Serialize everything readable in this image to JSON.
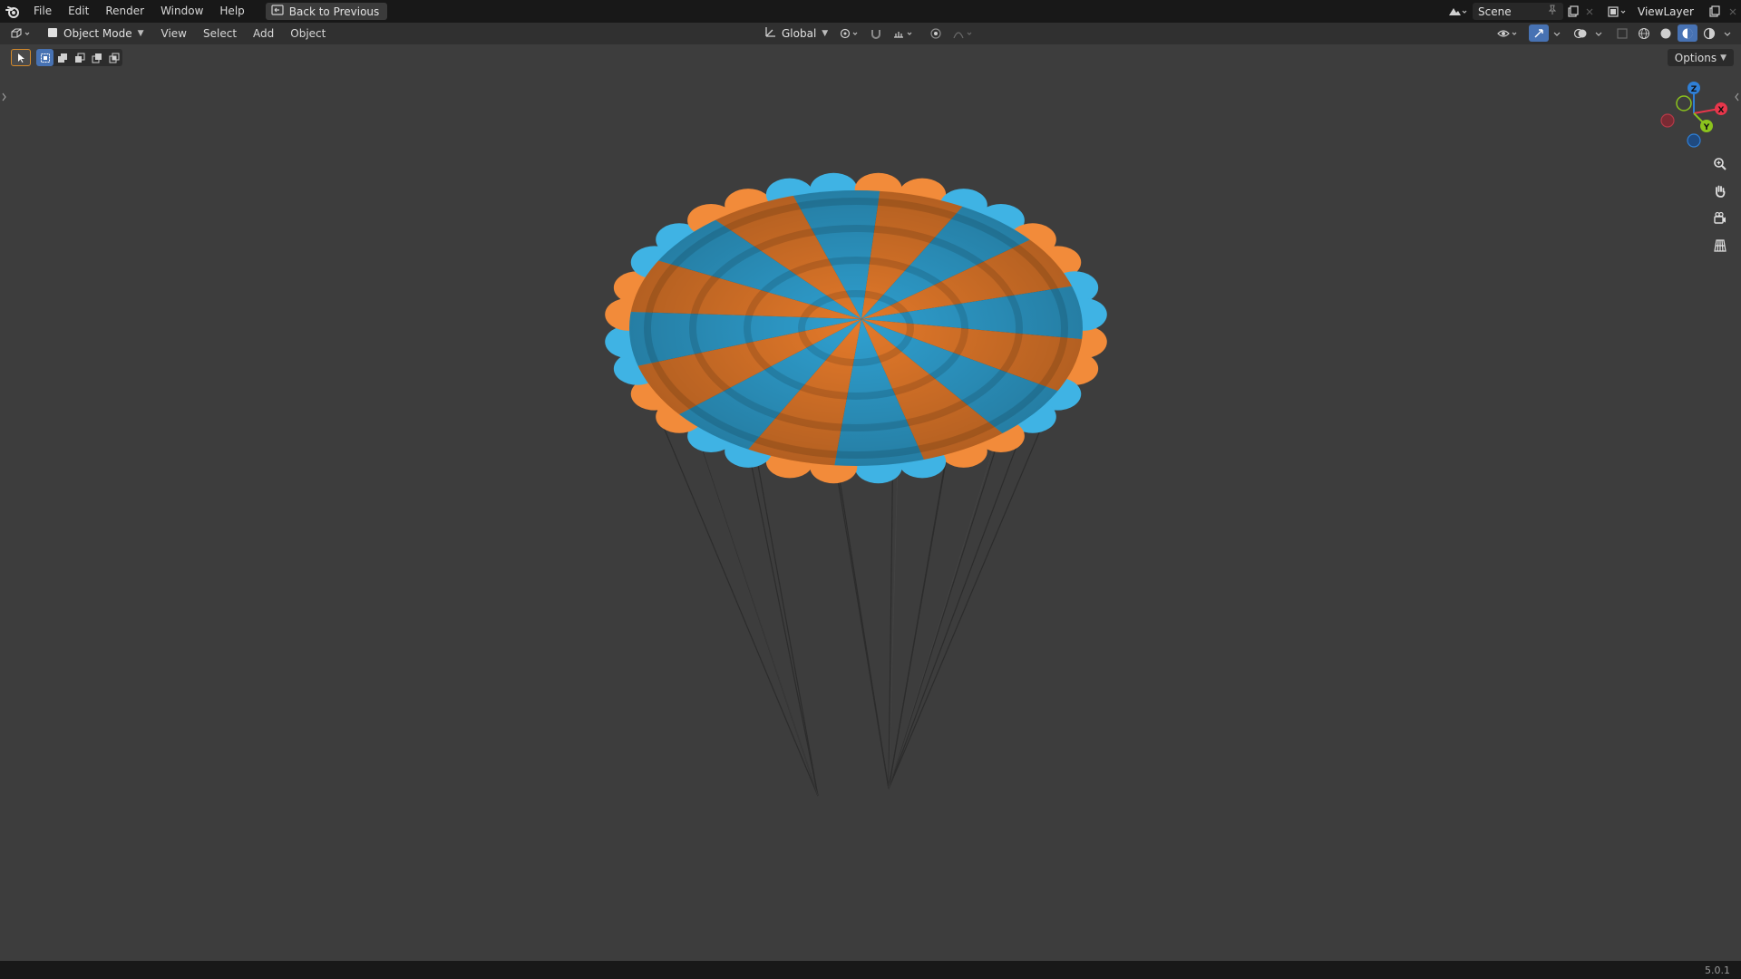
{
  "topbar": {
    "menu": [
      "File",
      "Edit",
      "Render",
      "Window",
      "Help"
    ],
    "back_label": "Back to Previous",
    "scene_name": "Scene",
    "view_layer_name": "ViewLayer"
  },
  "header": {
    "mode_label": "Object Mode",
    "menus": [
      "View",
      "Select",
      "Add",
      "Object"
    ],
    "transform_orientation": "Global"
  },
  "viewport": {
    "options_label": "Options",
    "gizmo_axes": [
      "Z",
      "X",
      "Y"
    ]
  },
  "status": {
    "version": "5.0.1"
  },
  "colors": {
    "canopy_orange": "#e3792a",
    "canopy_blue": "#2f9fcf",
    "axis_x": "#e8364b",
    "axis_y": "#8bc31d",
    "axis_z": "#2f7fd6"
  }
}
